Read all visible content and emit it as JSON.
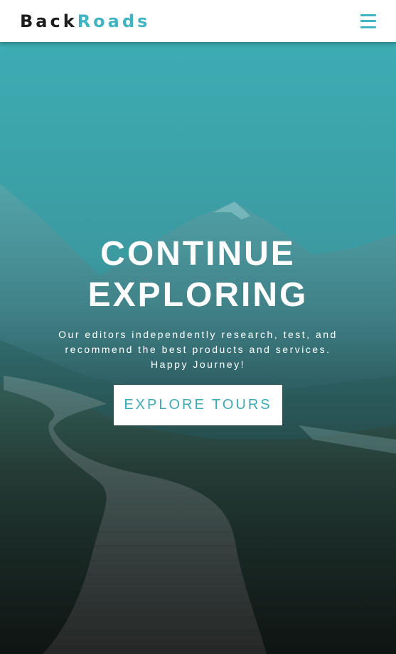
{
  "header": {
    "logo_part1": "Back",
    "logo_part2": "Roads",
    "menu_icon": "hamburger-menu-icon"
  },
  "hero": {
    "title_line1": "CONTINUE",
    "title_line2": "EXPLORING",
    "description": "Our editors independently research, test, and recommend the best products and services. Happy Journey!",
    "button_label": "EXPLORE TOURS"
  },
  "colors": {
    "brand_accent": "#40b4c0",
    "logo_dark": "#1d1d1d",
    "header_bg": "#ffffff",
    "button_text": "#40a9b4"
  }
}
